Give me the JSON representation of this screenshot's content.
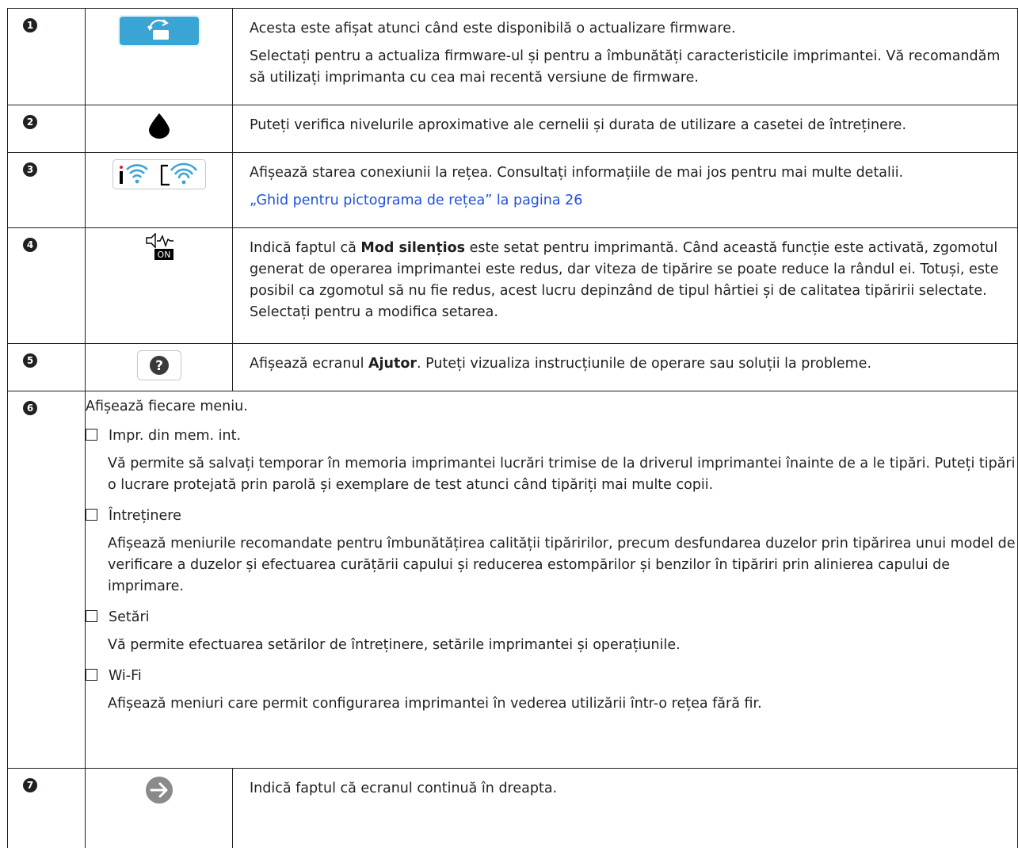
{
  "rows": [
    {
      "num": "1",
      "icon": "firmware-update-icon",
      "paragraphs": [
        "Acesta este afișat atunci când este disponibilă o actualizare firmware.",
        "Selectați pentru a actualiza firmware-ul și pentru a îmbunătăți caracteristicile imprimantei. Vă recomandăm să utilizați imprimanta cu cea mai recentă versiune de firmware."
      ]
    },
    {
      "num": "2",
      "icon": "ink-drop-icon",
      "text": "Puteți verifica nivelurile aproximative ale cernelii și durata de utilizare a casetei de întreținere."
    },
    {
      "num": "3",
      "icon": "network-status-icon",
      "text": "Afișează starea conexiunii la rețea. Consultați informațiile de mai jos pentru mai multe detalii.",
      "link": "„Ghid pentru pictograma de rețea” la pagina 26"
    },
    {
      "num": "4",
      "icon": "quiet-mode-icon",
      "icon_badge": "ON",
      "pre": "Indică faptul că ",
      "bold": "Mod silențios",
      "post": " este setat pentru imprimantă. Când această funcție este activată, zgomotul generat de operarea imprimantei este redus, dar viteza de tipărire se poate reduce la rândul ei. Totuși, este posibil ca zgomotul să nu fie redus, acest lucru depinzând de tipul hârtiei și de calitatea tipăririi selectate. Selectați pentru a modifica setarea."
    },
    {
      "num": "5",
      "icon": "help-icon",
      "pre": "Afișează ecranul ",
      "bold": "Ajutor",
      "post": ". Puteți vizualiza instrucțiunile de operare sau soluții la probleme."
    },
    {
      "num": "6",
      "intro": "Afișează fiecare meniu.",
      "items": [
        {
          "title": "Impr. din mem. int.",
          "desc": "Vă permite să salvați temporar în memoria imprimantei lucrări trimise de la driverul imprimantei înainte de a le tipări. Puteți tipări o lucrare protejată prin parolă și exemplare de test atunci când tipăriți mai multe copii."
        },
        {
          "title": "Întreținere",
          "desc": "Afișează meniurile recomandate pentru îmbunătățirea calității tipăririlor, precum desfundarea duzelor prin tipărirea unui model de verificare a duzelor și efectuarea curățării capului și reducerea estompărilor și benzilor în tipăriri prin alinierea capului de imprimare."
        },
        {
          "title": "Setări",
          "desc": "Vă permite efectuarea setărilor de întreținere, setările imprimantei și operațiunile."
        },
        {
          "title": "Wi-Fi",
          "desc": "Afișează meniuri care permit configurarea imprimantei în vederea utilizării într-o rețea fără fir."
        }
      ]
    },
    {
      "num": "7",
      "icon": "next-arrow-icon",
      "text": "Indică faptul că ecranul continuă în dreapta."
    }
  ]
}
